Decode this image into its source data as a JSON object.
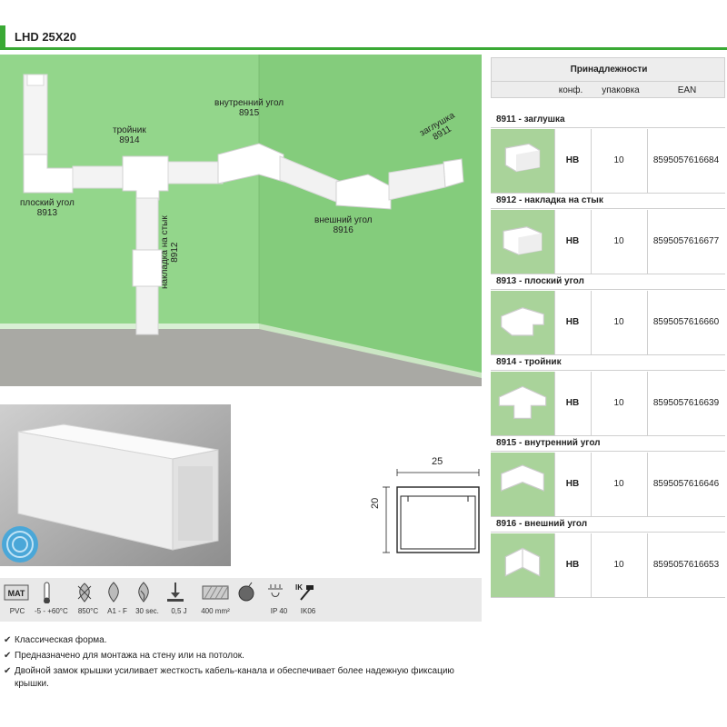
{
  "header": {
    "title": "LHD 25X20",
    "accent": "#3aa935"
  },
  "scene": {
    "labels": {
      "t_name": "тройник",
      "t_code": "8914",
      "inner_name": "внутренний угол",
      "inner_code": "8915",
      "cap_name": "заглушка",
      "cap_code": "8911",
      "flat_name": "плоский угол",
      "flat_code": "8913",
      "outer_name": "внешний угол",
      "outer_code": "8916",
      "joint_name": "накладка на стык",
      "joint_code": "8912"
    },
    "wall_color": "#8fd488",
    "floor_color": "#a9a9a4"
  },
  "drawing": {
    "width_label": "25",
    "height_label": "20"
  },
  "accessories": {
    "title": "Принадлежности",
    "columns": [
      "конф.",
      "упаковка",
      "EAN"
    ],
    "rows": [
      {
        "title": "8911 - заглушка",
        "conf": "HB",
        "pack": "10",
        "ean": "8595057616684",
        "icon": "end-cap-icon"
      },
      {
        "title": "8912 - накладка на стык",
        "conf": "HB",
        "pack": "10",
        "ean": "8595057616677",
        "icon": "joint-cover-icon"
      },
      {
        "title": "8913 - плоский угол",
        "conf": "HB",
        "pack": "10",
        "ean": "8595057616660",
        "icon": "flat-corner-icon"
      },
      {
        "title": "8914 - тройник",
        "conf": "HB",
        "pack": "10",
        "ean": "8595057616639",
        "icon": "tee-icon"
      },
      {
        "title": "8915 - внутренний угол",
        "conf": "HB",
        "pack": "10",
        "ean": "8595057616646",
        "icon": "inner-corner-icon"
      },
      {
        "title": "8916 - внешний угол",
        "conf": "HB",
        "pack": "10",
        "ean": "8595057616653",
        "icon": "outer-corner-icon"
      }
    ],
    "thumb_color": "#a9d39a"
  },
  "properties": [
    {
      "icon": "material-icon",
      "badge": "MAT",
      "label": "PVC"
    },
    {
      "icon": "thermometer-icon",
      "label": "-5 - +60°C"
    },
    {
      "icon": "glow-wire-icon",
      "label": "850°C"
    },
    {
      "icon": "flame-icon",
      "label": "A1 - F"
    },
    {
      "icon": "flame-time-icon",
      "label": "30 sec."
    },
    {
      "icon": "impact-energy-icon",
      "label": "0,5 J"
    },
    {
      "icon": "cross-section-icon",
      "label": "400 mm²"
    },
    {
      "icon": "uv-ball-icon",
      "label": ""
    },
    {
      "icon": "ip-rating-icon",
      "label": "IP 40"
    },
    {
      "icon": "ik-hammer-icon",
      "badge": "IK",
      "label": "IK06"
    }
  ],
  "features": [
    "Классическая форма.",
    "Предназначено для монтажа на стену или на потолок.",
    "Двойной замок крышки усиливает жесткость кабель-канала и обеспечивает более надежную фиксацию",
    "крышки."
  ]
}
